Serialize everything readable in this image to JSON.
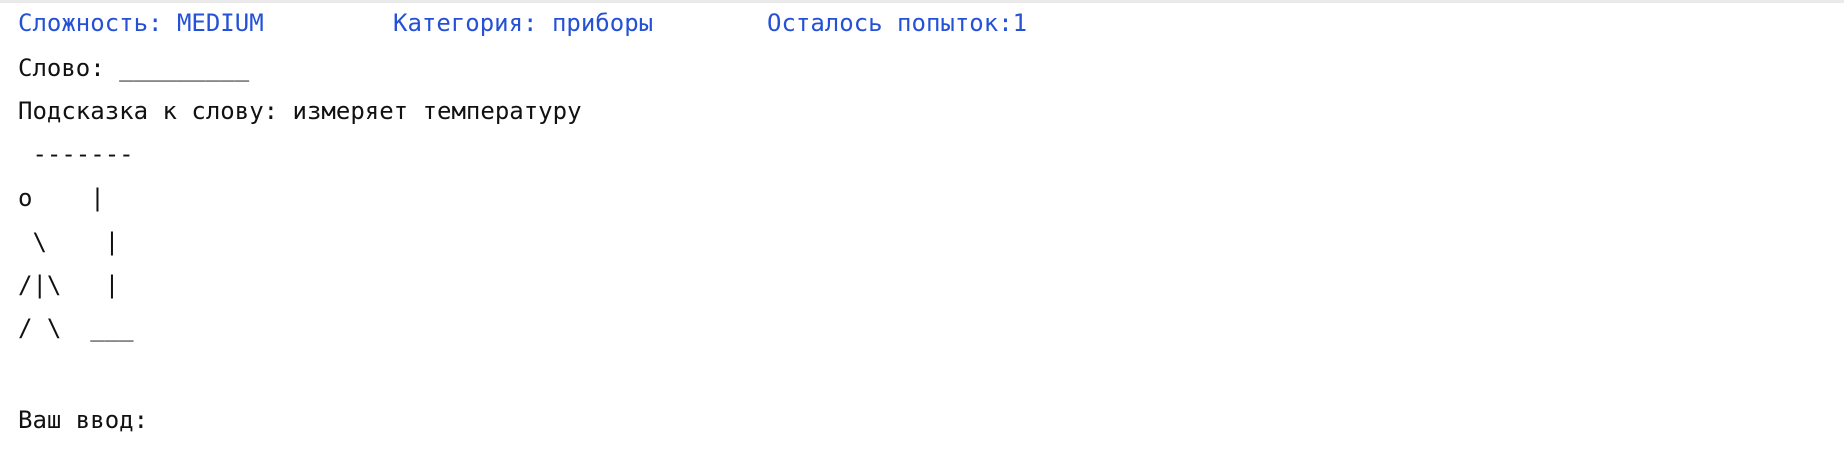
{
  "status": {
    "difficulty": "Сложность: MEDIUM",
    "category": "Категория: приборы",
    "attempts": "Осталось попыток:1"
  },
  "game": {
    "word_line": "Слово: _________",
    "hint_line": "Подсказка к слову: измеряет температуру",
    "gallows": [
      " -------",
      "o    |",
      " \\    |",
      "/|\\   |",
      "/ \\  ___"
    ],
    "input_prompt": "Ваш ввод:"
  },
  "colors": {
    "status_text": "#2451d6",
    "body_text": "#111111"
  }
}
